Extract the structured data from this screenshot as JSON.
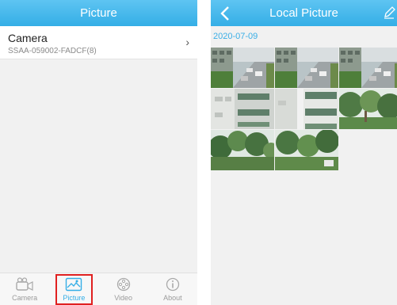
{
  "left_screen": {
    "title": "Picture",
    "device": {
      "name": "Camera",
      "id": "SSAA-059002-FADCF(8)"
    },
    "tabs": [
      {
        "label": "Camera",
        "icon": "camera-icon",
        "active": false
      },
      {
        "label": "Picture",
        "icon": "picture-icon",
        "active": true
      },
      {
        "label": "Video",
        "icon": "video-icon",
        "active": false
      },
      {
        "label": "About",
        "icon": "info-icon",
        "active": false
      }
    ]
  },
  "right_screen": {
    "title": "Local Picture",
    "date_group": "2020-07-09",
    "thumbnails": [
      {
        "scene": "parking-lot"
      },
      {
        "scene": "parking-lot"
      },
      {
        "scene": "parking-lot"
      },
      {
        "scene": "parking-lot"
      },
      {
        "scene": "building-wall"
      },
      {
        "scene": "building-wall"
      },
      {
        "scene": "trees"
      },
      {
        "scene": "building-wall"
      },
      {
        "scene": "trees"
      },
      {
        "scene": "trees"
      }
    ]
  },
  "colors": {
    "header": "#34aee6",
    "accent": "#3aaee6",
    "highlight_box": "#e02020",
    "background": "#f1f1f1"
  }
}
